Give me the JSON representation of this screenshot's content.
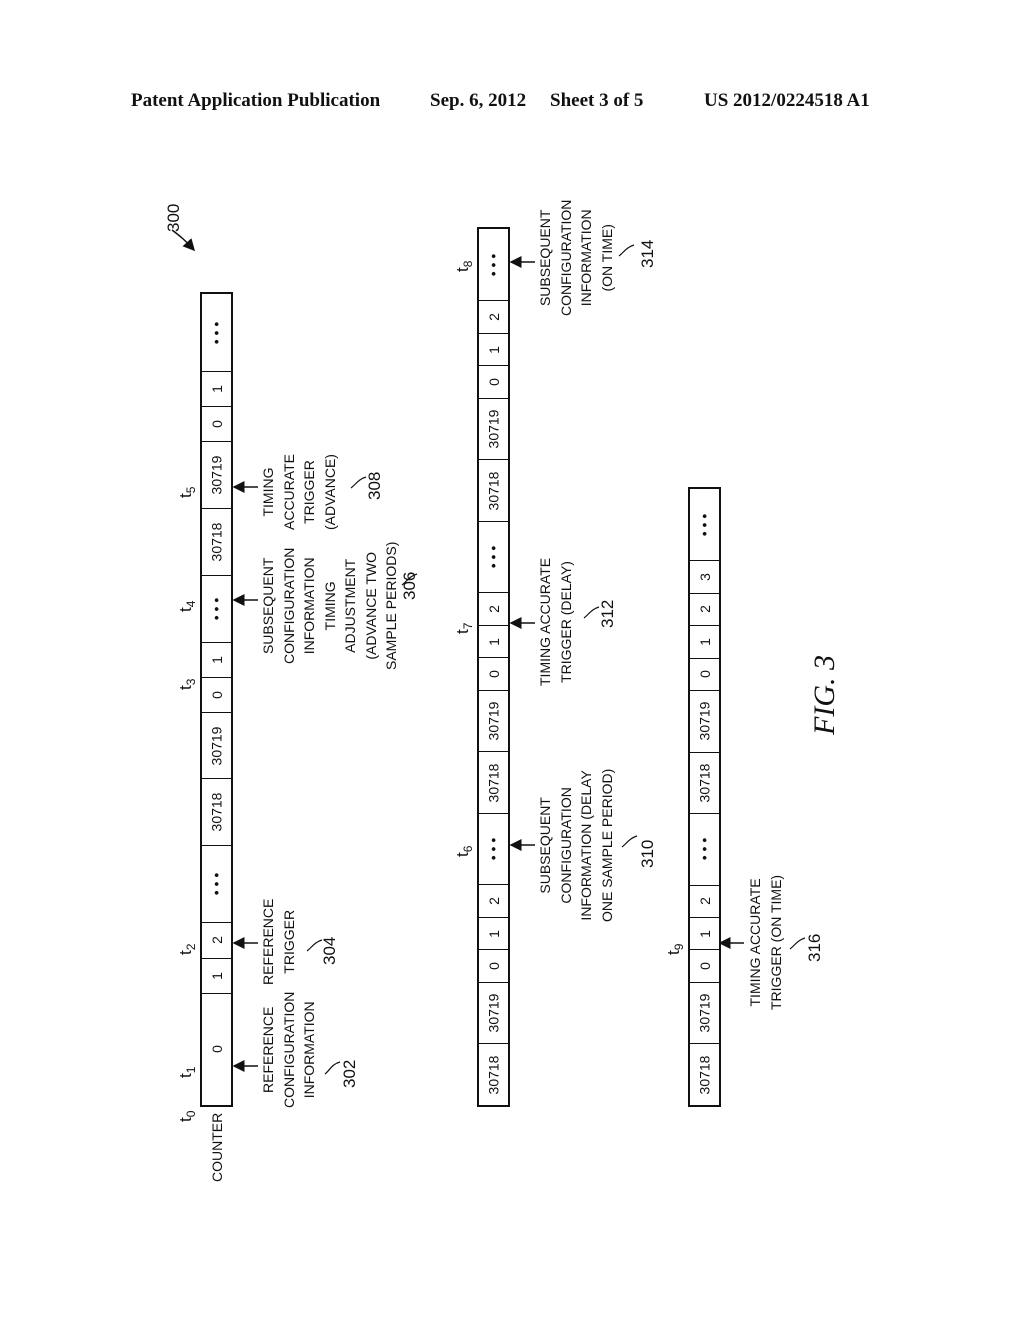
{
  "header": {
    "publication": "Patent Application Publication",
    "date": "Sep. 6, 2012",
    "sheet": "Sheet 3 of 5",
    "number": "US 2012/0224518 A1"
  },
  "figure": {
    "ref_number": "300",
    "caption": "FIG. 3",
    "counter_label": "COUNTER",
    "rows": [
      {
        "cells": [
          "0",
          "1",
          "2",
          "• • •",
          "30718",
          "30719",
          "0",
          "1",
          "• • •",
          "30718",
          "30719",
          "0",
          "1",
          "• • •"
        ]
      },
      {
        "cells": [
          "30718",
          "30719",
          "0",
          "1",
          "2",
          "• • •",
          "30718",
          "30719",
          "0",
          "1",
          "2",
          "• • •",
          "30718",
          "30719",
          "0",
          "1",
          "2",
          "• • •"
        ]
      },
      {
        "cells": [
          "30718",
          "30719",
          "0",
          "1",
          "2",
          "• • •",
          "30718",
          "30719",
          "0",
          "1",
          "2",
          "3",
          "• • •"
        ]
      }
    ],
    "time_labels": [
      "t0",
      "t1",
      "t2",
      "t3",
      "t4",
      "t5",
      "t6",
      "t7",
      "t8",
      "t9"
    ],
    "annotations": [
      {
        "ref": "302",
        "text": "REFERENCE\nCONFIGURATION\nINFORMATION"
      },
      {
        "ref": "304",
        "text": "REFERENCE\nTRIGGER"
      },
      {
        "ref": "306",
        "text": "SUBSEQUENT\nCONFIGURATION\nINFORMATION\nTIMING\nADJUSTMENT\n(ADVANCE TWO\nSAMPLE PERIODS)"
      },
      {
        "ref": "308",
        "text": "TIMING\nACCURATE\nTRIGGER\n(ADVANCE)"
      },
      {
        "ref": "310",
        "text": "SUBSEQUENT\nCONFIGURATION\nINFORMATION (DELAY\nONE SAMPLE PERIOD)"
      },
      {
        "ref": "312",
        "text": "TIMING ACCURATE\nTRIGGER (DELAY)"
      },
      {
        "ref": "314",
        "text": "SUBSEQUENT\nCONFIGURATION\nINFORMATION\n(ON TIME)"
      },
      {
        "ref": "316",
        "text": "TIMING ACCURATE\nTRIGGER (ON TIME)"
      }
    ]
  }
}
